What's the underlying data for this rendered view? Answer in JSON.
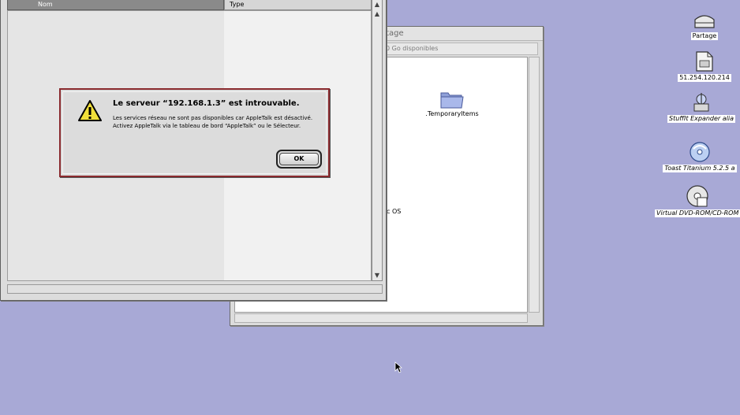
{
  "desktop": {
    "background_color": "#a8a9d6",
    "icons": [
      {
        "name": "shared-volume-icon",
        "label": "Partage"
      },
      {
        "name": "ftp-server-icon",
        "label": "51.254.120.214"
      },
      {
        "name": "stuffit-expander-icon",
        "label": "StuffIt Expander alia"
      },
      {
        "name": "toast-titanium-icon",
        "label": "Toast Titanium 5.2.5 a"
      },
      {
        "name": "virtual-dvd-icon",
        "label": "Virtual DVD-ROM/CD-ROM"
      }
    ]
  },
  "back_window": {
    "title": "rtage",
    "info": "0 Go disponibles",
    "items": [
      {
        "label": ".TemporaryItems",
        "icon": "folder-icon"
      }
    ],
    "partial_text": "c OS"
  },
  "front_window": {
    "columns": [
      "Nom",
      "Type"
    ]
  },
  "alert": {
    "title": "Le serveur “192.168.1.3” est introuvable.",
    "message": "Les services réseau ne sont pas disponibles car AppleTalk est désactivé. Activez AppleTalk via le tableau de bord “AppleTalk” ou le Sélecteur.",
    "ok_label": "OK",
    "border_color": "#8a2a2e"
  }
}
